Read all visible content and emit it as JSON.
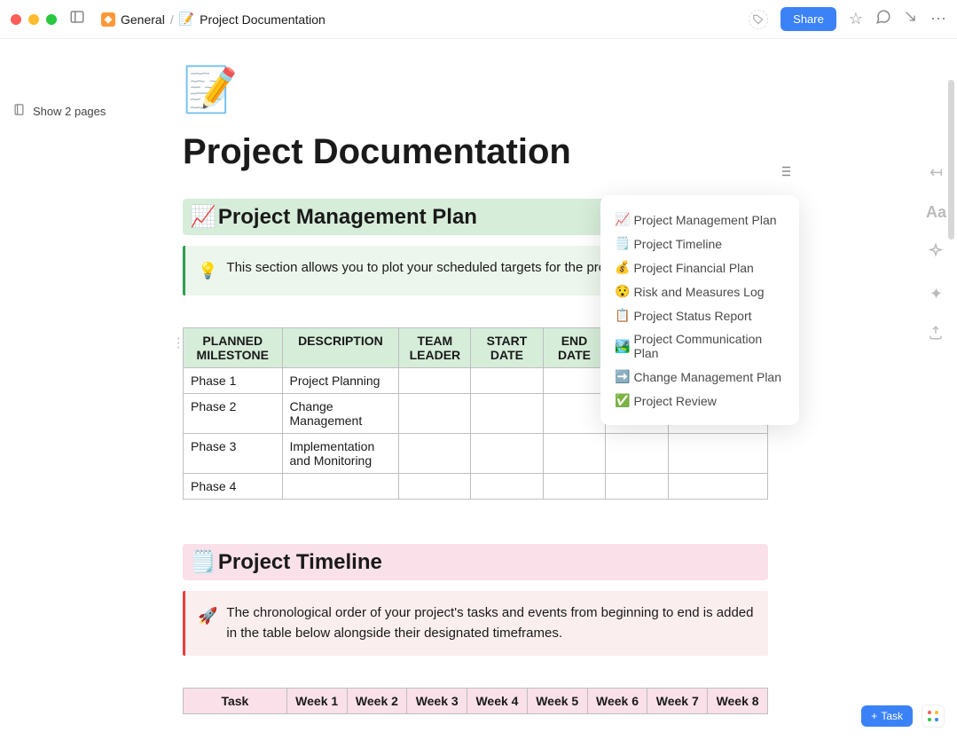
{
  "breadcrumb": {
    "root": "General",
    "page": "Project Documentation",
    "page_emoji": "📝"
  },
  "header": {
    "share": "Share",
    "show_pages": "Show 2 pages"
  },
  "doc": {
    "icon": "📝",
    "title": "Project Documentation"
  },
  "sections": {
    "plan": {
      "emoji": "📈",
      "title": "Project Management Plan",
      "callout_emoji": "💡",
      "callout": "This section allows you to plot your scheduled targets for the pro"
    },
    "timeline": {
      "emoji": "🗒️",
      "title": "Project Timeline",
      "callout_emoji": "🚀",
      "callout": "The chronological order of your project's tasks and events from beginning to end is added in the table below alongside their designated timeframes."
    }
  },
  "plan_table": {
    "headers": [
      "PLANNED MILESTONE",
      "DESCRIPTION",
      "TEAM LEADER",
      "START DATE",
      "END DATE",
      "",
      ""
    ],
    "rows": [
      [
        "Phase 1",
        "Project Planning",
        "",
        "",
        "",
        "",
        ""
      ],
      [
        "Phase 2",
        "Change Management",
        "",
        "",
        "",
        "",
        ""
      ],
      [
        "Phase 3",
        "Implementation and Monitoring",
        "",
        "",
        "",
        "",
        ""
      ],
      [
        "Phase 4",
        "",
        "",
        "",
        "",
        "",
        ""
      ]
    ]
  },
  "timeline_table": {
    "headers": [
      "Task",
      "Week 1",
      "Week 2",
      "Week 3",
      "Week 4",
      "Week 5",
      "Week 6",
      "Week 7",
      "Week 8"
    ]
  },
  "toc": [
    {
      "emoji": "📈",
      "label": "Project Management Plan"
    },
    {
      "emoji": "🗒️",
      "label": "Project Timeline"
    },
    {
      "emoji": "💰",
      "label": "Project Financial Plan"
    },
    {
      "emoji": "😯",
      "label": "Risk and Measures Log"
    },
    {
      "emoji": "📋",
      "label": "Project Status Report"
    },
    {
      "emoji": "🏞️",
      "label": "Project Communication Plan"
    },
    {
      "emoji": "➡️",
      "label": "Change Management Plan"
    },
    {
      "emoji": "✅",
      "label": "Project Review"
    }
  ],
  "task_button": "Task"
}
